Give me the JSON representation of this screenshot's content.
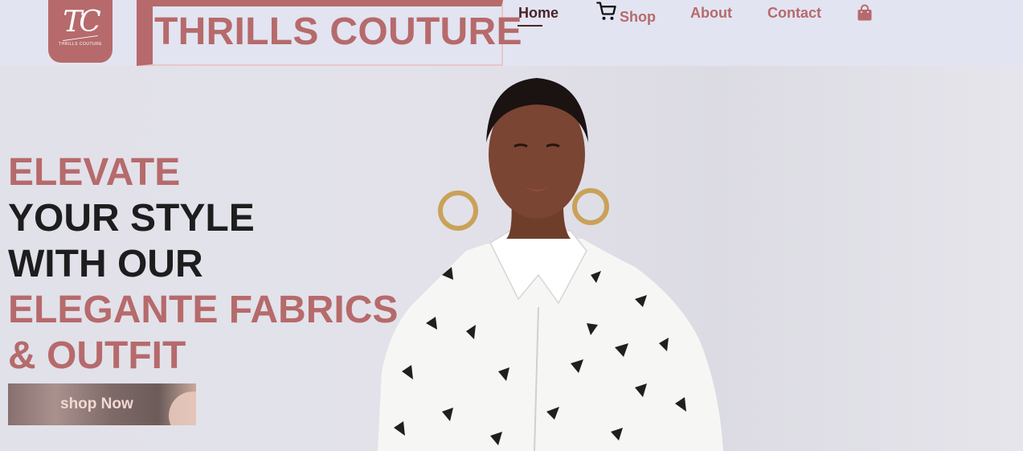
{
  "brand": {
    "logo_monogram": "TC",
    "logo_subtitle": "THRILLS COUTURE",
    "name": "THRILLS COUTURE"
  },
  "nav": {
    "home": "Home",
    "shop": "Shop",
    "about": "About",
    "contact": "Contact",
    "cart_icon": "cart-icon",
    "bag_icon": "shopping-bag-icon"
  },
  "hero": {
    "headline": {
      "line1": "ELEVATE",
      "line2": "YOUR STYLE",
      "line3": "WITH OUR",
      "line4": "ELEGANTE FABRICS",
      "line5": "& OUTFIT"
    },
    "cta": "shop Now"
  },
  "colors": {
    "accent": "#b66a6b",
    "header_bg": "#e3e4f1",
    "dark_text": "#1e1d1e",
    "active_nav": "#4b2328"
  }
}
